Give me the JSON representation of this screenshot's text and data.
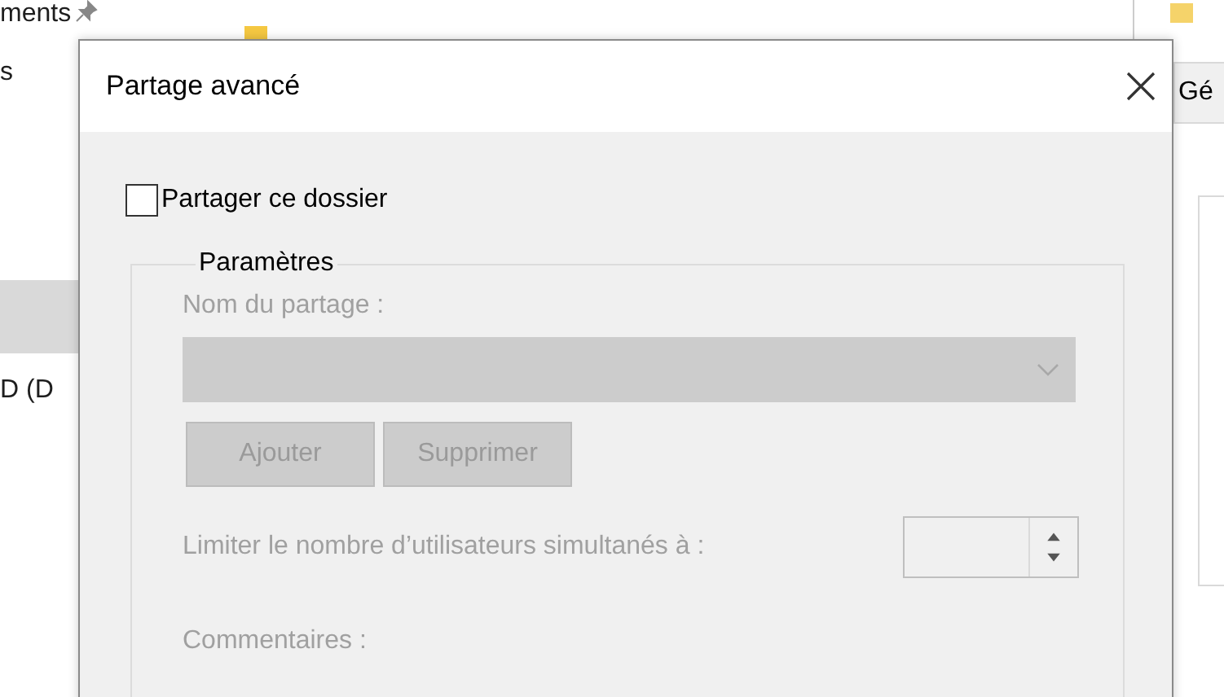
{
  "explorer": {
    "sidebar": [
      {
        "label": "ments",
        "pinned": true,
        "selected": false
      },
      {
        "label": "s",
        "pinned": false,
        "selected": false
      },
      {
        "selected": true
      },
      {
        "label": "D (D",
        "pinned": false,
        "selected": false
      }
    ],
    "properties_tab": "Gé"
  },
  "dialog": {
    "title": "Partage avancé",
    "share_checkbox": {
      "label": "Partager ce dossier",
      "checked": false
    },
    "group": {
      "legend": "Paramètres",
      "share_name": {
        "label": "Nom du partage :",
        "disabled": true
      },
      "buttons": [
        {
          "label": "Ajouter",
          "disabled": true
        },
        {
          "label": "Supprimer",
          "disabled": true
        }
      ],
      "limit": {
        "label": "Limiter le nombre d’utilisateurs simultanés à :",
        "disabled": true
      },
      "comments": {
        "label": "Commentaires :",
        "disabled": true
      }
    }
  }
}
